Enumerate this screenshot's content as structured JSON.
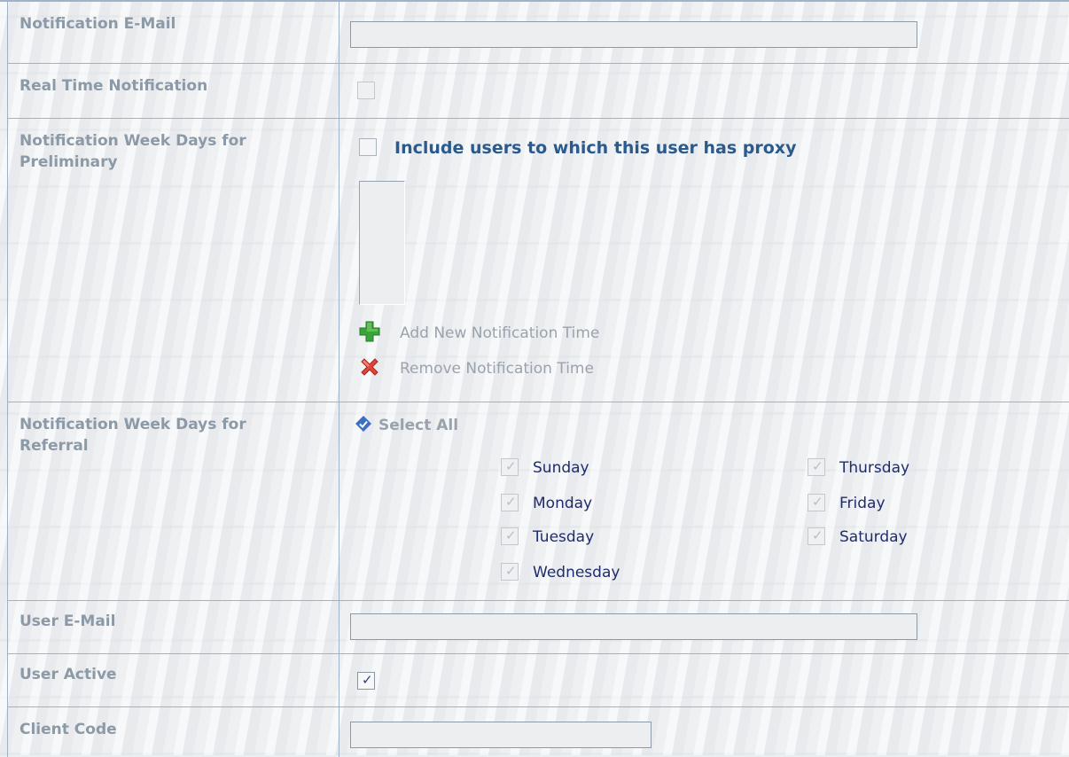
{
  "rows": {
    "notification_email": {
      "label": "Notification E-Mail",
      "value": ""
    },
    "real_time_notification": {
      "label": "Real Time Notification",
      "checked": false
    },
    "preliminary": {
      "label": "Notification Week Days for Preliminary",
      "proxy_label": "Include users to which this user has proxy",
      "proxy_checked": false,
      "times": [],
      "add_label": "Add New Notification Time",
      "remove_label": "Remove Notification Time"
    },
    "referral": {
      "label": "Notification Week Days for Referral",
      "select_all_label": "Select All",
      "days": [
        {
          "name": "Sunday",
          "checked": true
        },
        {
          "name": "Monday",
          "checked": true
        },
        {
          "name": "Tuesday",
          "checked": true
        },
        {
          "name": "Wednesday",
          "checked": true
        },
        {
          "name": "Thursday",
          "checked": true
        },
        {
          "name": "Friday",
          "checked": true
        },
        {
          "name": "Saturday",
          "checked": true
        }
      ]
    },
    "user_email": {
      "label": "User E-Mail",
      "value": ""
    },
    "user_active": {
      "label": "User Active",
      "checked": true
    },
    "client_code": {
      "label": "Client Code",
      "value": ""
    }
  },
  "icons": {
    "add": "plus-icon",
    "remove": "x-icon",
    "select_all": "diamond-arrow-icon"
  },
  "colors": {
    "label_text": "#8c99a6",
    "link_text": "#2a5a8e",
    "day_text": "#1f2c6b",
    "border": "#9fb3c8",
    "add_icon": "#3aa43a",
    "remove_icon": "#e0453a",
    "select_all_icon": "#3b6fc4"
  }
}
